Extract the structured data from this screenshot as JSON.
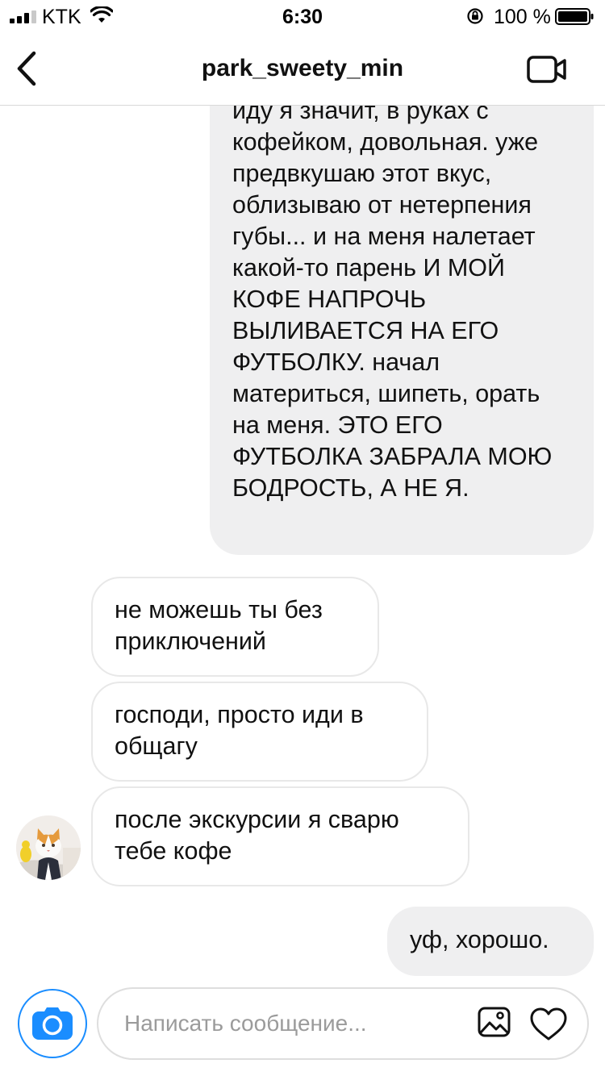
{
  "status_bar": {
    "carrier": "KTK",
    "time": "6:30",
    "battery_percent": "100 %",
    "signal_bars": 3,
    "battery_level": 1.0
  },
  "header": {
    "title": "park_sweety_min",
    "back_icon": "chevron-left-icon",
    "video_icon": "video-camera-icon"
  },
  "messages": [
    {
      "direction": "outgoing",
      "text": "иду я значит, в руках с кофейком, довольная. уже предвкушаю этот вкус, облизываю от нетерпения губы... и на меня налетает какой-то парень И МОЙ КОФЕ НАПРОЧЬ ВЫЛИВАЕТСЯ НА ЕГО ФУТБОЛКУ. начал материться, шипеть, орать на меня. ЭТО ЕГО ФУТБОЛКА ЗАБРАЛА МОЮ БОДРОСТЬ, А НЕ Я."
    },
    {
      "direction": "incoming",
      "text": "не можешь ты без приключений"
    },
    {
      "direction": "incoming",
      "text": "господи, просто иди в общагу"
    },
    {
      "direction": "incoming",
      "text": "после экскурсии я сварю тебе кофе"
    },
    {
      "direction": "outgoing",
      "text": "уф, хорошо."
    }
  ],
  "composer": {
    "placeholder": "Написать сообщение...",
    "camera_icon": "camera-icon",
    "gallery_icon": "gallery-icon",
    "like_icon": "heart-icon"
  },
  "colors": {
    "accent": "#1a8dff",
    "outgoing_bubble": "#efeff0",
    "incoming_border": "#e8e8e8",
    "placeholder": "#9b9b9b"
  }
}
